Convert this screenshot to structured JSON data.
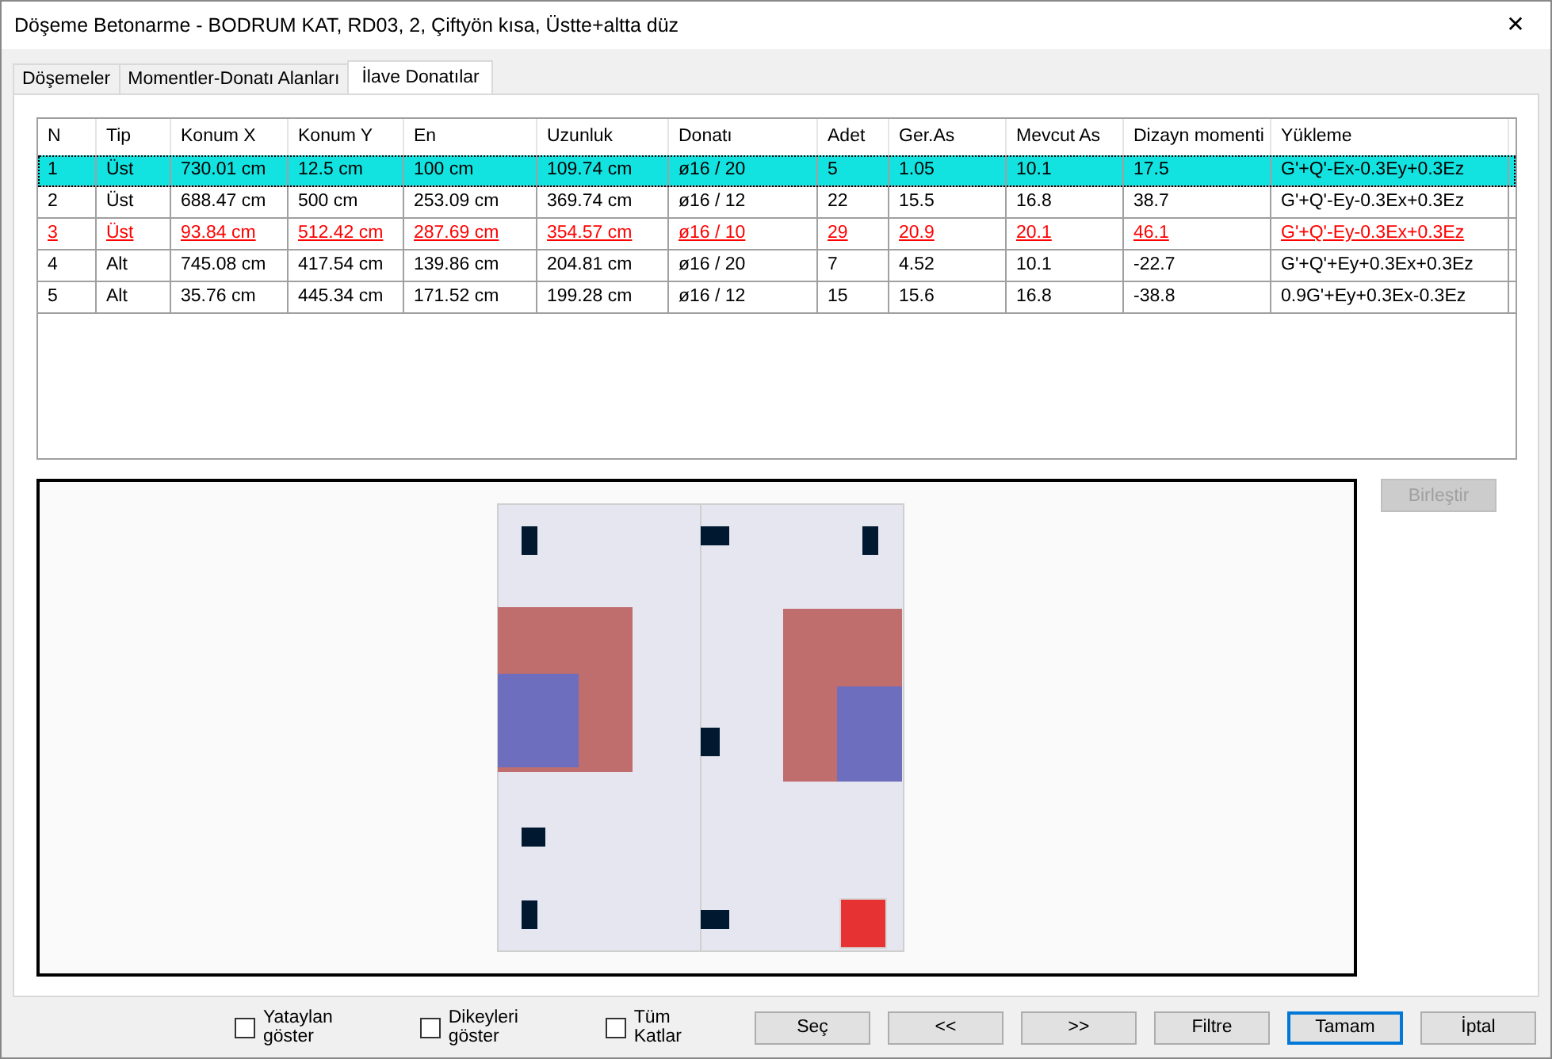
{
  "window": {
    "title": "Döşeme Betonarme - BODRUM KAT, RD03, 2, Çiftyön kısa, Üstte+altta düz",
    "close": "✕"
  },
  "tabs": [
    {
      "label": "Döşemeler",
      "selected": false
    },
    {
      "label": "Momentler-Donatı Alanları",
      "selected": false
    },
    {
      "label": "İlave Donatılar",
      "selected": true
    }
  ],
  "table": {
    "columns": [
      "N",
      "Tip",
      "Konum X",
      "Konum Y",
      "En",
      "Uzunluk",
      "Donatı",
      "Adet",
      "Ger.As",
      "Mevcut As",
      "Dizayn momenti",
      "Yükleme"
    ],
    "rows": [
      {
        "selected": true,
        "warning": false,
        "cells": [
          "1",
          "Üst",
          "730.01 cm",
          "12.5 cm",
          "100 cm",
          "109.74 cm",
          "ø16 / 20",
          "5",
          "1.05",
          "10.1",
          "17.5",
          "G'+Q'-Ex-0.3Ey+0.3Ez"
        ]
      },
      {
        "selected": false,
        "warning": false,
        "cells": [
          "2",
          "Üst",
          "688.47 cm",
          "500 cm",
          "253.09 cm",
          "369.74 cm",
          "ø16 / 12",
          "22",
          "15.5",
          "16.8",
          "38.7",
          "G'+Q'-Ey-0.3Ex+0.3Ez"
        ]
      },
      {
        "selected": false,
        "warning": true,
        "cells": [
          "3",
          "Üst",
          "93.84 cm",
          "512.42 cm",
          "287.69 cm",
          "354.57 cm",
          "ø16 / 10",
          "29",
          "20.9",
          "20.1",
          "46.1",
          "G'+Q'-Ey-0.3Ex+0.3Ez"
        ]
      },
      {
        "selected": false,
        "warning": false,
        "cells": [
          "4",
          "Alt",
          "745.08 cm",
          "417.54 cm",
          "139.86 cm",
          "204.81 cm",
          "ø16 / 20",
          "7",
          "4.52",
          "10.1",
          "-22.7",
          "G'+Q'+Ey+0.3Ex+0.3Ez"
        ]
      },
      {
        "selected": false,
        "warning": false,
        "cells": [
          "5",
          "Alt",
          "35.76 cm",
          "445.34 cm",
          "171.52 cm",
          "199.28 cm",
          "ø16 / 12",
          "15",
          "15.6",
          "16.8",
          "-38.8",
          "0.9G'+Ey+0.3Ex-0.3Ez"
        ]
      }
    ]
  },
  "merge_button": {
    "label": "Birleştir",
    "disabled": true
  },
  "checkboxes": [
    {
      "label": "Yataylan göster",
      "checked": false
    },
    {
      "label": "Dikeyleri göster",
      "checked": false
    },
    {
      "label": "Tüm Katlar",
      "checked": false
    }
  ],
  "buttons": [
    {
      "label": "Seç",
      "default": false
    },
    {
      "label": "<<",
      "default": false
    },
    {
      "label": ">>",
      "default": false
    },
    {
      "label": "Filtre",
      "default": false
    },
    {
      "label": "Tamam",
      "default": true
    },
    {
      "label": "İptal",
      "default": false
    }
  ]
}
